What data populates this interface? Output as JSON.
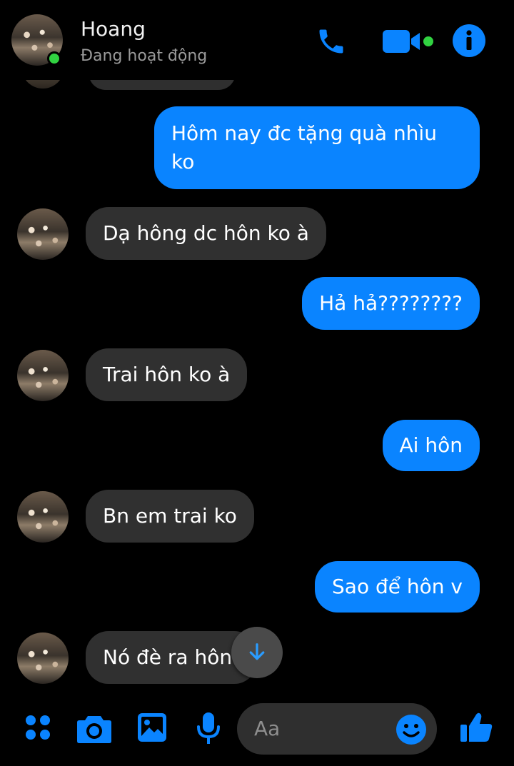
{
  "header": {
    "contact_name": "Hoang",
    "status": "Đang hoạt động",
    "accent": "#0a84ff",
    "online_color": "#31d241",
    "icons": [
      "phone-icon",
      "video-call-icon",
      "info-icon"
    ]
  },
  "messages": [
    {
      "from": "me",
      "text": "Hôm nay đc tặng quà nhìu ko"
    },
    {
      "from": "them",
      "text": "Dạ hông dc hôn ko à"
    },
    {
      "from": "me",
      "text": "Hả hả????????"
    },
    {
      "from": "them",
      "text": "Trai hôn ko à"
    },
    {
      "from": "me",
      "text": "Ai hôn"
    },
    {
      "from": "them",
      "text": "Bn em trai ko"
    },
    {
      "from": "me",
      "text": "Sao để hôn v"
    },
    {
      "from": "them",
      "text": "Nó đè ra hôn"
    }
  ],
  "composer": {
    "placeholder": "Aa",
    "icons": [
      "apps-icon",
      "camera-icon",
      "gallery-icon",
      "microphone-icon",
      "emoji-icon",
      "thumbs-up-icon"
    ]
  }
}
